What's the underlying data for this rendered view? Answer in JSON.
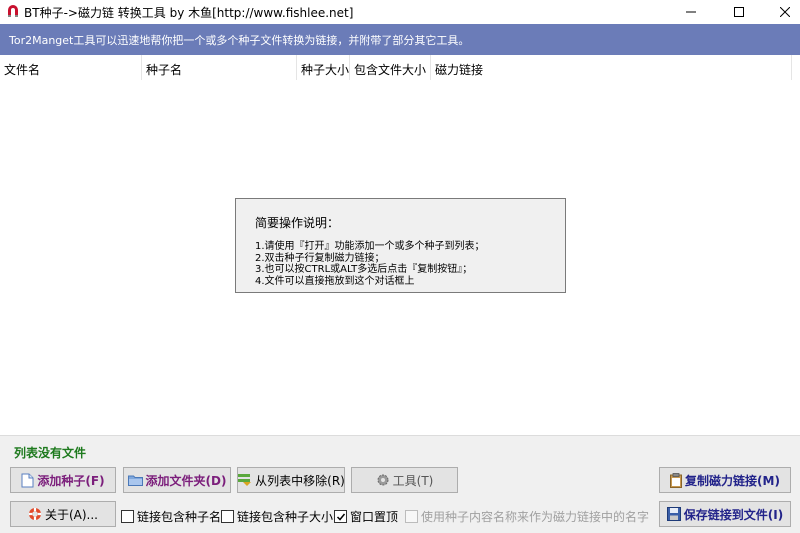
{
  "window": {
    "title": "BT种子->磁力链 转换工具 by 木鱼[http://www.fishlee.net]",
    "controls": {
      "minimize": "minimize-icon",
      "maximize": "maximize-icon",
      "close": "close-icon"
    }
  },
  "banner": {
    "text": "Tor2Manget工具可以迅速地帮你把一个或多个种子文件转换为链接，并附带了部分其它工具。"
  },
  "table": {
    "columns": [
      "文件名",
      "种子名",
      "种子大小",
      "包含文件大小",
      "磁力链接"
    ],
    "rows": []
  },
  "help": {
    "title": "简要操作说明：",
    "lines": [
      "1.请使用『打开』功能添加一个或多个种子到列表；",
      "2.双击种子行复制磁力链接；",
      "3.也可以按CTRL或ALT多选后点击『复制按钮』；",
      "4.文件可以直接拖放到这个对话框上"
    ]
  },
  "status": {
    "text": "列表没有文件",
    "color": "#1e7a1e"
  },
  "buttons": {
    "add_torrent": "添加种子(F)",
    "add_folder": "添加文件夹(D)",
    "remove": "从列表中移除(R)",
    "tools": "工具(T)",
    "copy_magnet": "复制磁力链接(M)",
    "about": "关于(A)...",
    "save_links": "保存链接到文件(I)"
  },
  "options": [
    {
      "label": "链接包含种子名",
      "checked": false,
      "enabled": true
    },
    {
      "label": "链接包含种子大小",
      "checked": false,
      "enabled": true
    },
    {
      "label": "窗口置顶",
      "checked": true,
      "enabled": true
    },
    {
      "label": "使用种子内容名称来作为磁力链接中的名字",
      "checked": false,
      "enabled": false
    }
  ],
  "colors": {
    "banner": "#6b7cb8",
    "accent_purple": "#7b1e7b",
    "accent_navy": "#22238a"
  }
}
